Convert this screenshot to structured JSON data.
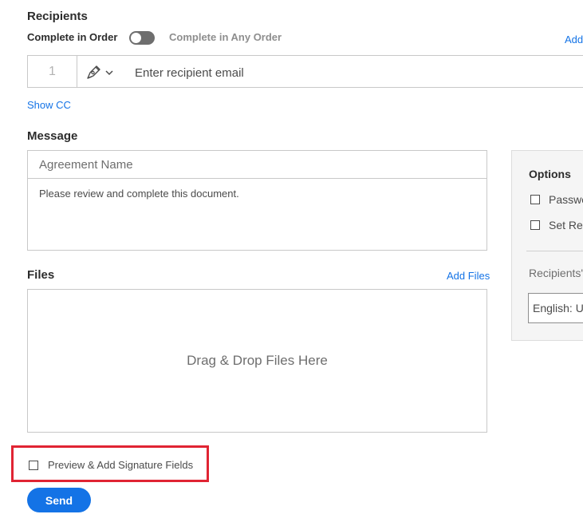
{
  "recipients": {
    "title": "Recipients",
    "complete_in_order": "Complete in Order",
    "complete_in_any_order": "Complete in Any Order",
    "add_link": "Add",
    "toggle_on": false,
    "row": {
      "number": "1",
      "role_icon": "pen-icon",
      "email_placeholder": "Enter recipient email"
    },
    "show_cc": "Show CC"
  },
  "message": {
    "title": "Message",
    "agreement_name_placeholder": "Agreement Name",
    "body": "Please review and complete this document."
  },
  "files": {
    "title": "Files",
    "add_files": "Add Files",
    "drop_text": "Drag & Drop Files Here"
  },
  "options": {
    "title": "Options",
    "items": [
      {
        "label": "Passwo",
        "checked": false
      },
      {
        "label": "Set Rer",
        "checked": false
      }
    ],
    "recipients_language_label": "Recipients'",
    "language_value": "English: U"
  },
  "preview": {
    "label": "Preview & Add Signature Fields",
    "checked": false
  },
  "send": {
    "label": "Send"
  },
  "colors": {
    "accent": "#1473e6",
    "highlight": "#e02433",
    "toggle_off": "#6e6e6e"
  }
}
